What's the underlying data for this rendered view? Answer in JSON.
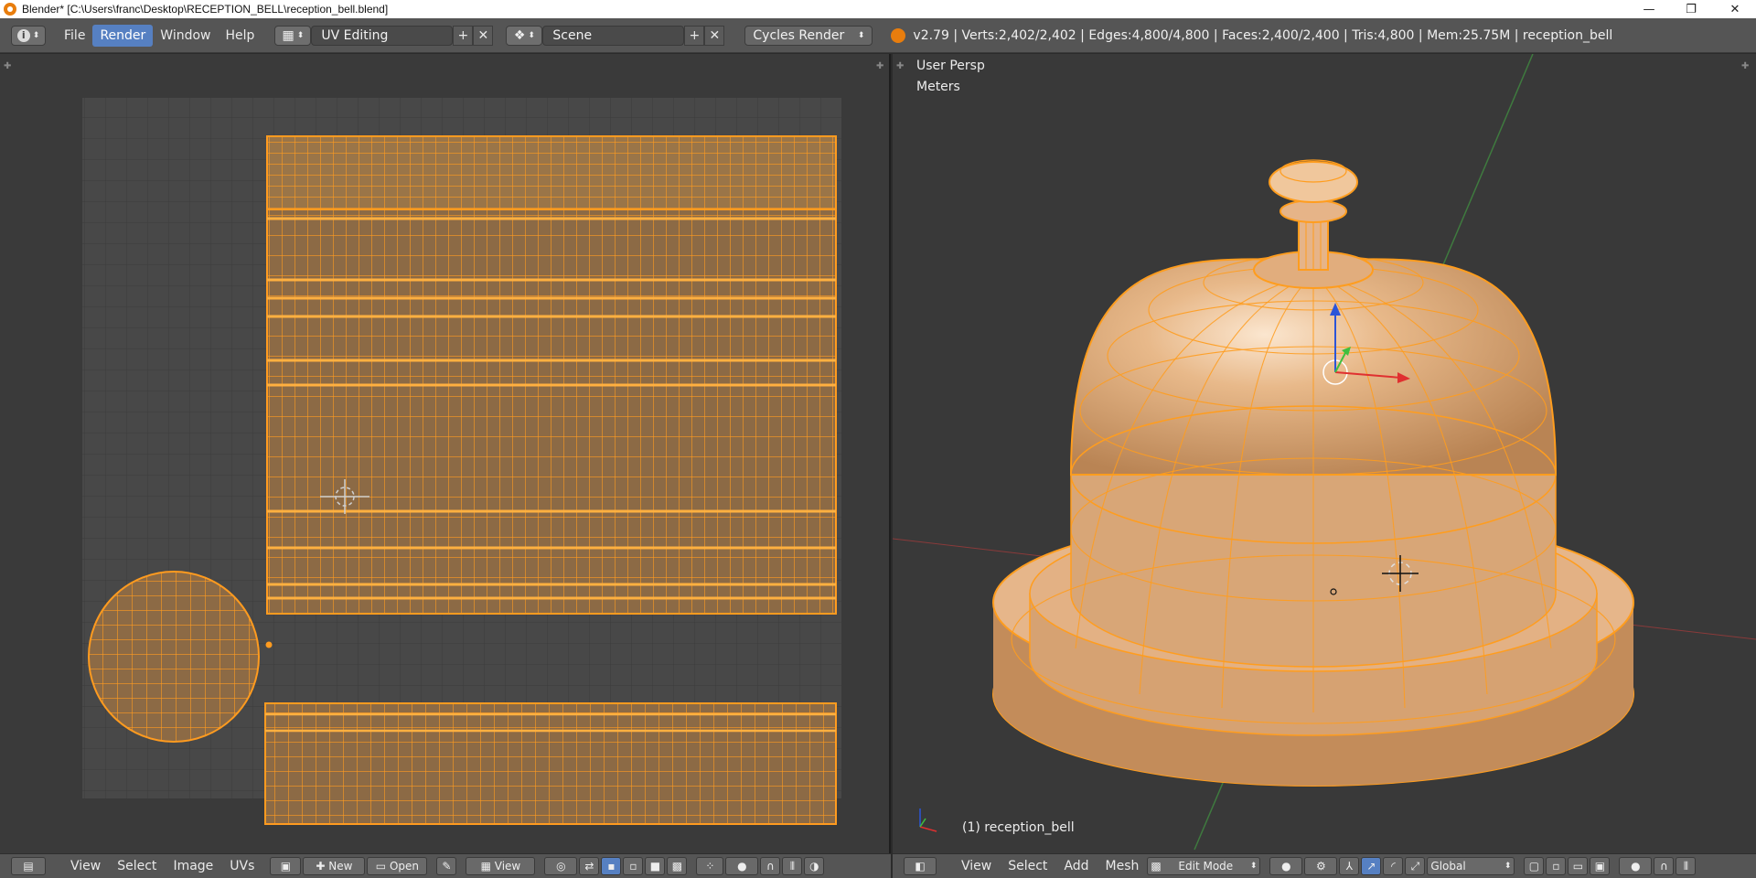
{
  "window": {
    "title": "Blender* [C:\\Users\\franc\\Desktop\\RECEPTION_BELL\\reception_bell.blend]",
    "minimize": "—",
    "restore": "❐",
    "close": "✕"
  },
  "info_header": {
    "menus": [
      "File",
      "Render",
      "Window",
      "Help"
    ],
    "active_menu": "Render",
    "screen_layout": "UV Editing",
    "scene": "Scene",
    "render_engine": "Cycles Render",
    "stats": "v2.79 | Verts:2,402/2,402 | Edges:4,800/4,800 | Faces:2,400/2,400 | Tris:4,800 | Mem:25.75M | reception_bell"
  },
  "uv_editor": {
    "menus": [
      "View",
      "Select",
      "Image",
      "UVs"
    ],
    "new_label": "New",
    "open_label": "Open",
    "view_label": "View"
  },
  "viewport": {
    "view_name": "User Persp",
    "units": "Meters",
    "object_label": "(1) reception_bell",
    "menus": [
      "View",
      "Select",
      "Add",
      "Mesh"
    ],
    "mode": "Edit Mode",
    "orientation": "Global"
  },
  "colors": {
    "accent": "#5680c2",
    "uv_selected": "#f5a02a",
    "mesh_fill": "#d9a97c",
    "mesh_wire": "#ff9d1e"
  }
}
